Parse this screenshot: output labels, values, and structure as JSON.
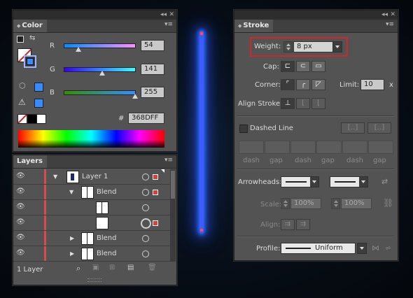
{
  "color_panel": {
    "tab": "Color",
    "r": {
      "label": "R",
      "value": "54"
    },
    "g": {
      "label": "G",
      "value": "141"
    },
    "b": {
      "label": "B",
      "value": "255"
    },
    "hash": "#",
    "hex": "368DFF",
    "fill_color": "#368DFF"
  },
  "layers_panel": {
    "tab": "Layers",
    "rows": [
      {
        "name": "Layer 1"
      },
      {
        "name": "Blend"
      },
      {
        "name": ""
      },
      {
        "name": ""
      },
      {
        "name": "Blend"
      },
      {
        "name": "Blend"
      }
    ],
    "footer": "1 Layer"
  },
  "stroke_panel": {
    "tab": "Stroke",
    "weight_label": "Weight:",
    "weight_value": "8 px",
    "cap_label": "Cap:",
    "corner_label": "Corner:",
    "limit_label": "Limit:",
    "limit_value": "10",
    "limit_unit": "x",
    "align_label": "Align Stroke:",
    "dashed_label": "Dashed Line",
    "dash_labels": [
      "dash",
      "gap",
      "dash",
      "gap",
      "dash",
      "gap"
    ],
    "arrowheads_label": "Arrowheads:",
    "scale_label": "Scale:",
    "scale_1": "100%",
    "scale_2": "100%",
    "align2_label": "Align:",
    "profile_label": "Profile:",
    "profile_value": "Uniform"
  },
  "canvas": {
    "line_color": "#3a55ff",
    "glow_color": "#2f6bff",
    "endpoint_color": "#ff4a5a"
  }
}
